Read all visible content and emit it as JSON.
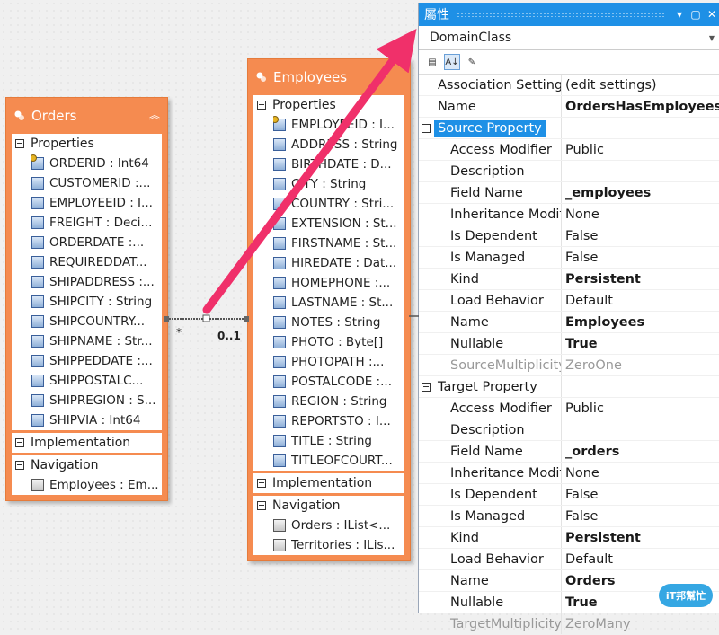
{
  "orders": {
    "title": "Orders",
    "properties_label": "Properties",
    "properties": [
      "ORDERID : Int64",
      "CUSTOMERID  :...",
      "EMPLOYEEID : I...",
      "FREIGHT : Deci...",
      "ORDERDATE  :...",
      "REQUIREDDAT...",
      "SHIPADDRESS  :...",
      "SHIPCITY : String",
      "SHIPCOUNTRY...",
      "SHIPNAME : Str...",
      "SHIPPEDDATE  :...",
      "SHIPPOSTALC...",
      "SHIPREGION : S...",
      "SHIPVIA : Int64"
    ],
    "implementation_label": "Implementation",
    "navigation_label": "Navigation",
    "navigation": [
      "Employees : Em..."
    ]
  },
  "employees": {
    "title": "Employees",
    "properties_label": "Properties",
    "properties": [
      "EMPLOYEEID : I...",
      "ADDRESS : String",
      "BIRTHDATE : D...",
      "CITY : String",
      "COUNTRY : Stri...",
      "EXTENSION : St...",
      "FIRSTNAME : St...",
      "HIREDATE : Dat...",
      "HOMEPHONE  :...",
      "LASTNAME : St...",
      "NOTES : String",
      "PHOTO : Byte[]",
      "PHOTOPATH  :...",
      "POSTALCODE  :...",
      "REGION : String",
      "REPORTSTO : I...",
      "TITLE : String",
      "TITLEOFCOURT..."
    ],
    "implementation_label": "Implementation",
    "navigation_label": "Navigation",
    "navigation": [
      "Orders : IList<...",
      "Territories : ILis..."
    ]
  },
  "association": {
    "left_mult": "*",
    "right_mult": "0..1"
  },
  "panel": {
    "title": "屬性",
    "domain": "DomainClass",
    "rows": [
      {
        "name": "Association Settings",
        "value": "(edit settings)",
        "kind": "plain"
      },
      {
        "name": "Name",
        "value": "OrdersHasEmployees",
        "kind": "plain",
        "bold": true
      },
      {
        "name": "Source Property",
        "value": "",
        "kind": "cat",
        "sel": true
      },
      {
        "name": "Access Modifier",
        "value": "Public",
        "kind": "sub"
      },
      {
        "name": "Description",
        "value": "",
        "kind": "sub"
      },
      {
        "name": "Field Name",
        "value": "_employees",
        "kind": "sub",
        "bold": true
      },
      {
        "name": "Inheritance Modif",
        "value": "None",
        "kind": "sub"
      },
      {
        "name": "Is Dependent",
        "value": "False",
        "kind": "sub"
      },
      {
        "name": "Is Managed",
        "value": "False",
        "kind": "sub"
      },
      {
        "name": "Kind",
        "value": "Persistent",
        "kind": "sub",
        "bold": true
      },
      {
        "name": "Load Behavior",
        "value": "Default",
        "kind": "sub"
      },
      {
        "name": "Name",
        "value": "Employees",
        "kind": "sub",
        "bold": true
      },
      {
        "name": "Nullable",
        "value": "True",
        "kind": "sub",
        "bold": true
      },
      {
        "name": "SourceMultiplicity",
        "value": "ZeroOne",
        "kind": "dim"
      },
      {
        "name": "Target Property",
        "value": "",
        "kind": "cat"
      },
      {
        "name": "Access Modifier",
        "value": "Public",
        "kind": "sub"
      },
      {
        "name": "Description",
        "value": "",
        "kind": "sub"
      },
      {
        "name": "Field Name",
        "value": "_orders",
        "kind": "sub",
        "bold": true
      },
      {
        "name": "Inheritance Modif",
        "value": "None",
        "kind": "sub"
      },
      {
        "name": "Is Dependent",
        "value": "False",
        "kind": "sub"
      },
      {
        "name": "Is Managed",
        "value": "False",
        "kind": "sub"
      },
      {
        "name": "Kind",
        "value": "Persistent",
        "kind": "sub",
        "bold": true
      },
      {
        "name": "Load Behavior",
        "value": "Default",
        "kind": "sub"
      },
      {
        "name": "Name",
        "value": "Orders",
        "kind": "sub",
        "bold": true
      },
      {
        "name": "Nullable",
        "value": "True",
        "kind": "sub",
        "bold": true
      },
      {
        "name": "TargetMultiplicity",
        "value": "ZeroMany",
        "kind": "dim"
      }
    ]
  },
  "watermark": "iT邦幫忙",
  "colors": {
    "entity_header": "#f58b50",
    "panel_title": "#1e90e6",
    "arrow": "#f0306a"
  }
}
